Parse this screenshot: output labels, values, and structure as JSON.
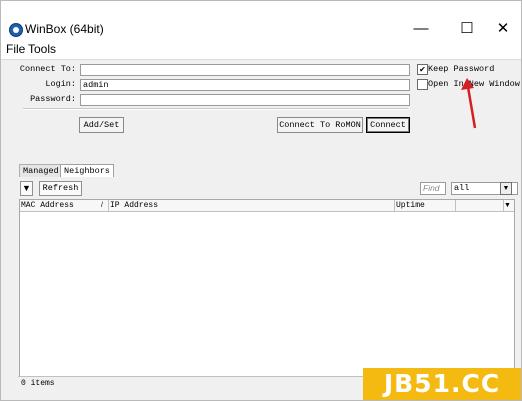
{
  "window": {
    "title": "WinBox (64bit)"
  },
  "menu": {
    "file": "File",
    "tools": "Tools"
  },
  "login": {
    "connect_to_label": "Connect To:",
    "connect_to_value": "",
    "login_label": "Login:",
    "login_value": "admin",
    "password_label": "Password:",
    "password_value": "",
    "keep_password_label": "Keep Password",
    "keep_password_checked": true,
    "open_new_window_label": "Open In New Window",
    "open_new_window_checked": false,
    "add_set_label": "Add/Set",
    "connect_romon_label": "Connect To RoMON",
    "connect_label": "Connect"
  },
  "tabs": [
    "Managed",
    "Neighbors"
  ],
  "toolbar": {
    "refresh_label": "Refresh",
    "find_placeholder": "Find",
    "filter_value": "all"
  },
  "table": {
    "columns": [
      "MAC Address",
      "IP Address",
      "Uptime"
    ],
    "rows": []
  },
  "status": {
    "items_count": "0 items"
  },
  "watermark": "JB51.CC",
  "colors": {
    "annotation_arrow": "#d42020",
    "watermark_bg": "#f5ba12"
  }
}
